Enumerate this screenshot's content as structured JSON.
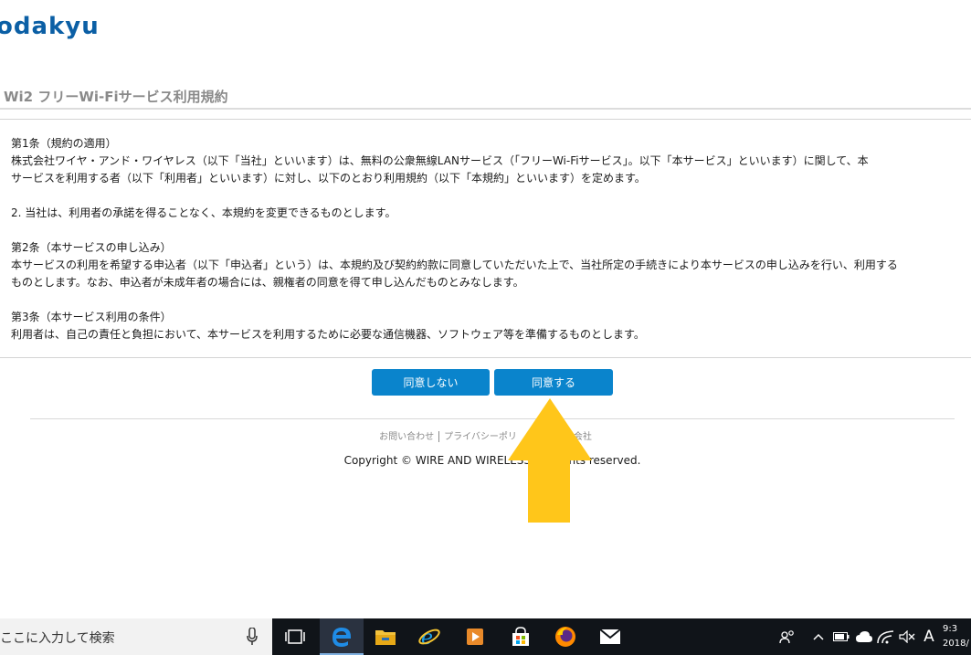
{
  "header": {
    "logo_text": "odakyu",
    "service_title": "Wi2 フリーWi-Fiサービス利用規約"
  },
  "terms": {
    "article1_heading": "第1条（規約の適用）",
    "article1_line1": "株式会社ワイヤ・アンド・ワイヤレス（以下「当社」といいます）は、無料の公衆無線LANサービス（「フリーWi-Fiサービス」。以下「本サービス」といいます）に関して、本",
    "article1_line2": "サービスを利用する者（以下「利用者」といいます）に対し、以下のとおり利用規約（以下「本規約」といいます）を定めます。",
    "article1_item2": "2. 当社は、利用者の承諾を得ることなく、本規約を変更できるものとします。",
    "article2_heading": "第2条（本サービスの申し込み）",
    "article2_line1": "本サービスの利用を希望する申込者（以下「申込者」という）は、本規約及び契約約款に同意していただいた上で、当社所定の手続きにより本サービスの申し込みを行い、利用する",
    "article2_line2": "ものとします。なお、申込者が未成年者の場合には、親権者の同意を得て申し込んだものとみなします。",
    "article3_heading": "第3条（本サービス利用の条件）",
    "article3_line1": "利用者は、自己の責任と負担において、本サービスを利用するために必要な通信機器、ソフトウェア等を準備するものとします。"
  },
  "buttons": {
    "disagree_label": "同意しない",
    "agree_label": "同意する"
  },
  "footer": {
    "links": [
      "お問い合わせ",
      "プライバシーポリ",
      "会社"
    ],
    "copyright": "Copyright © WIRE AND WIRELESS        ights reserved."
  },
  "annotation": {
    "arrow_color": "#ffc61a"
  },
  "taskbar": {
    "search_text": "ここに入力して検索",
    "ime_indicator": "A",
    "clock_time": "9:3",
    "clock_date": "2018/"
  },
  "colors": {
    "brand": "#0b5fa5",
    "button": "#0a84cc",
    "taskbar": "#101419"
  }
}
